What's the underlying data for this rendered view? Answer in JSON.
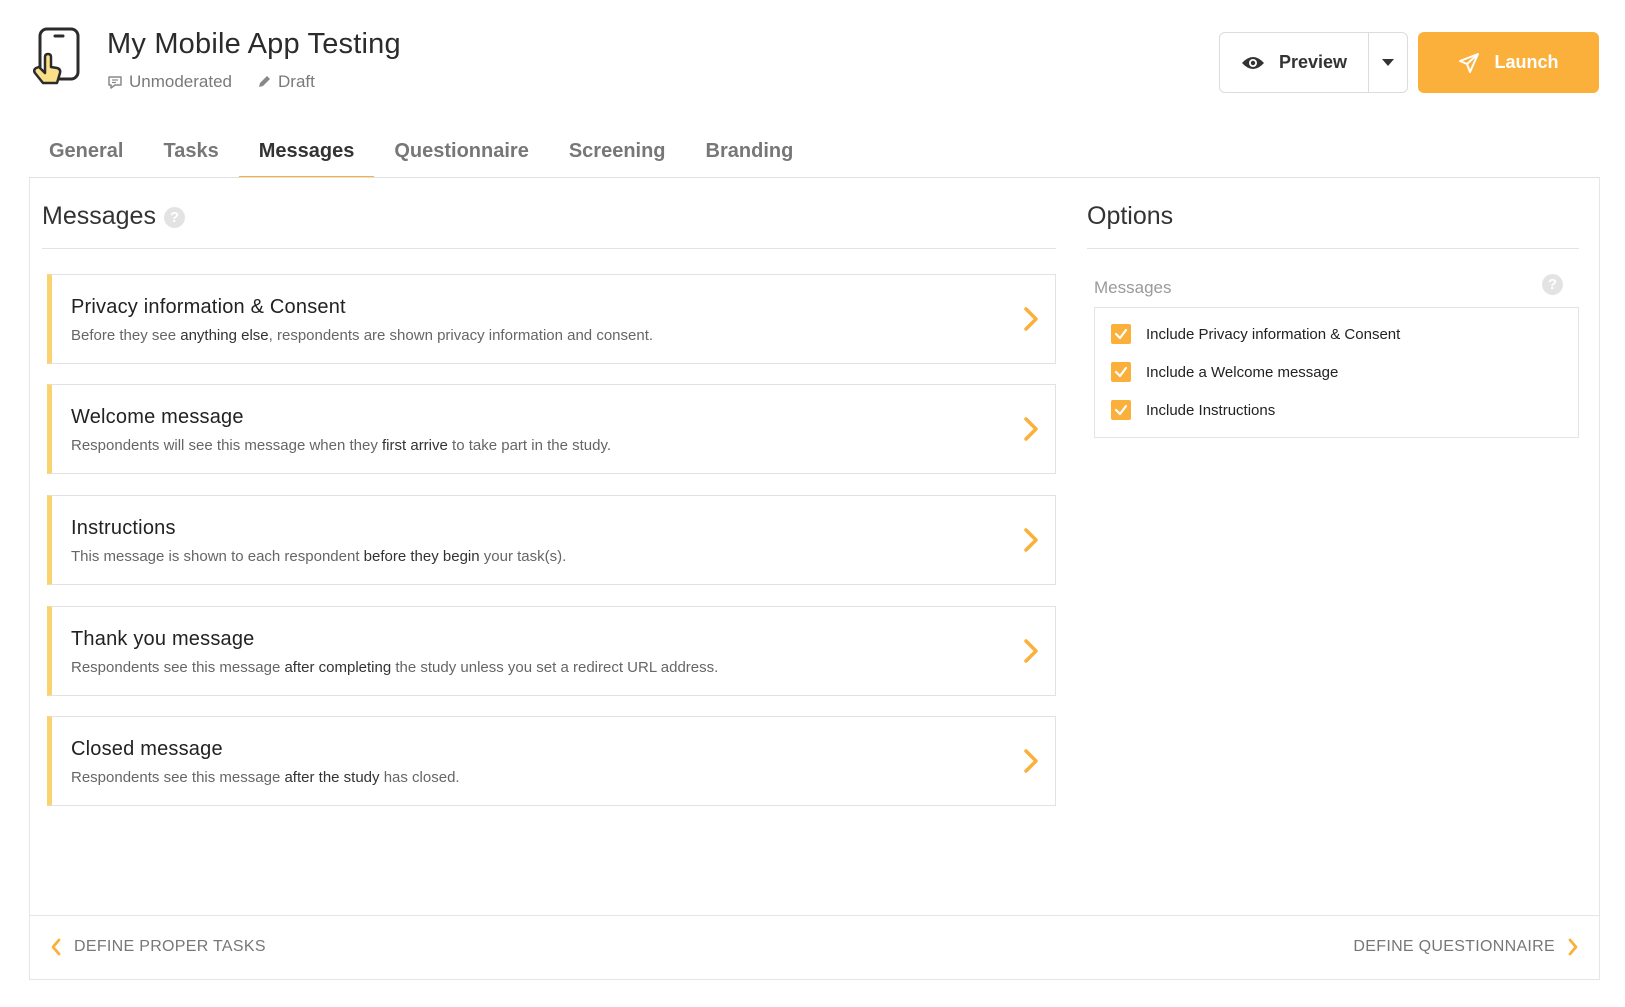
{
  "header": {
    "title": "My Mobile App Testing",
    "mode": "Unmoderated",
    "status": "Draft",
    "preview_label": "Preview",
    "launch_label": "Launch"
  },
  "tabs": [
    {
      "label": "General",
      "active": false
    },
    {
      "label": "Tasks",
      "active": false
    },
    {
      "label": "Messages",
      "active": true
    },
    {
      "label": "Questionnaire",
      "active": false
    },
    {
      "label": "Screening",
      "active": false
    },
    {
      "label": "Branding",
      "active": false
    }
  ],
  "messages": {
    "title": "Messages",
    "help": "?",
    "cards": [
      {
        "title": "Privacy information & Consent",
        "pre": "Before they see ",
        "bold": "anything else",
        "post": ", respondents are shown privacy information and consent."
      },
      {
        "title": "Welcome message",
        "pre": "Respondents will see this message when they ",
        "bold": "first arrive",
        "post": " to take part in the study."
      },
      {
        "title": "Instructions",
        "pre": "This message is shown to each respondent ",
        "bold": "before they begin",
        "post": " your task(s)."
      },
      {
        "title": "Thank you message",
        "pre": "Respondents see this message ",
        "bold": "after completing",
        "post": " the study unless you set a redirect URL address."
      },
      {
        "title": "Closed message",
        "pre": "Respondents see this message ",
        "bold": "after the study",
        "post": " has closed."
      }
    ]
  },
  "options": {
    "title": "Options",
    "group_label": "Messages",
    "help": "?",
    "items": [
      {
        "label": "Include Privacy information & Consent",
        "checked": true
      },
      {
        "label": "Include a Welcome message",
        "checked": true
      },
      {
        "label": "Include Instructions",
        "checked": true
      }
    ]
  },
  "footer": {
    "prev_label": "DEFINE PROPER TASKS",
    "next_label": "DEFINE QUESTIONNAIRE"
  },
  "colors": {
    "accent": "#fbb03b",
    "card_border_left": "#fbd270"
  },
  "icons": {
    "app": "phone-tap-icon",
    "mode": "chat-bubble-icon",
    "status": "pencil-icon",
    "preview": "eye-icon",
    "launch": "paper-plane-icon"
  }
}
